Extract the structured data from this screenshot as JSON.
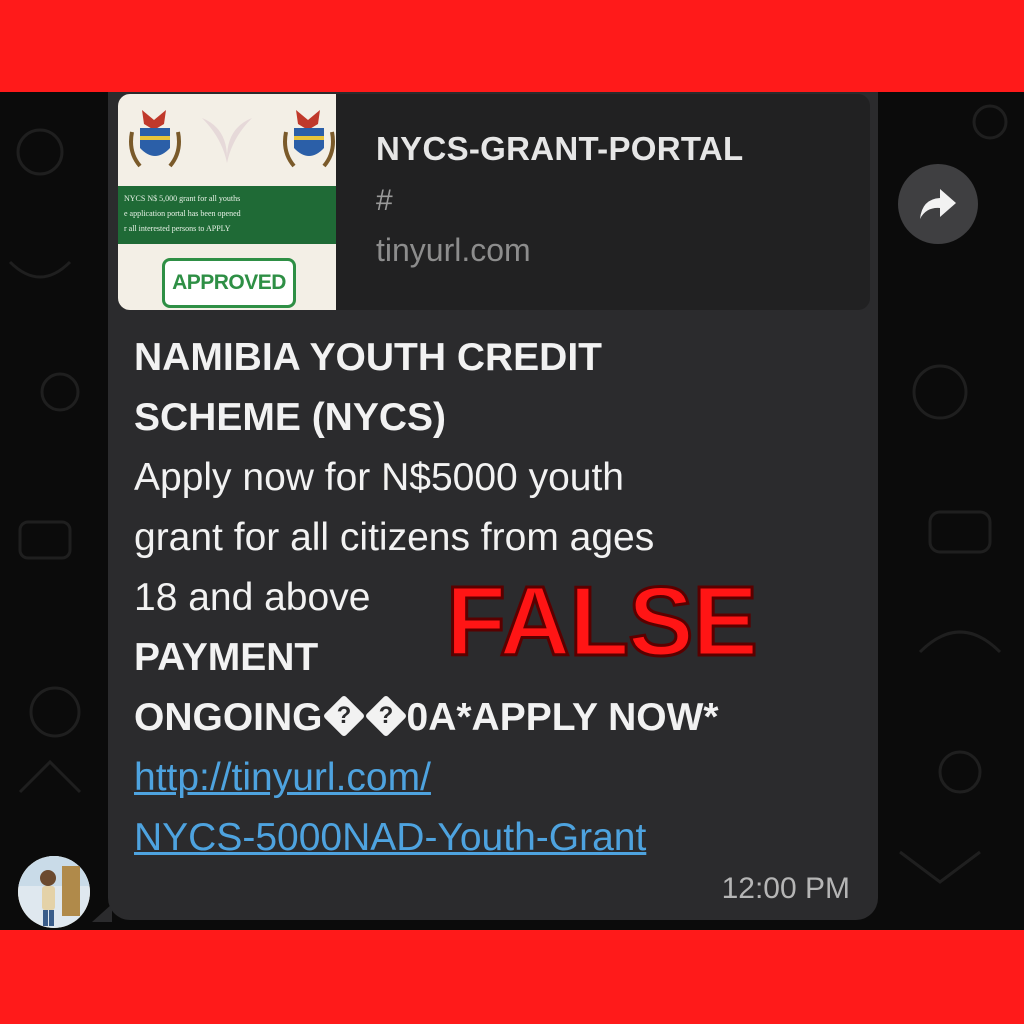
{
  "link_preview": {
    "title": "NYCS-GRANT-PORTAL",
    "description": "#",
    "domain": "tinyurl.com",
    "thumbnail": {
      "banner_lines": [
        "NYCS N$ 5,000 grant for all youths",
        "e application portal has been opened",
        "r all interested persons to APPLY"
      ],
      "stamp_text": "APPROVED"
    }
  },
  "message": {
    "lines": [
      "NAMIBIA YOUTH CREDIT",
      "SCHEME (NYCS)",
      "Apply now for N$5000 youth",
      "grant for all citizens from ages",
      "18 and above"
    ],
    "payment_label": "PAYMENT",
    "ongoing_prefix": "ONGOING",
    "replacement_char": "?",
    "ongoing_suffix": "0A*APPLY NOW*",
    "link_line_1": "http://tinyurl.com/",
    "link_line_2": "NYCS-5000NAD-Youth-Grant",
    "time": "12:00 PM"
  },
  "overlay": {
    "verdict": "FALSE",
    "verdict_color": "#ff1515",
    "frame_color": "#ff1a1a"
  },
  "icons": {
    "forward": "forward-arrow-icon",
    "avatar": "user-avatar"
  }
}
